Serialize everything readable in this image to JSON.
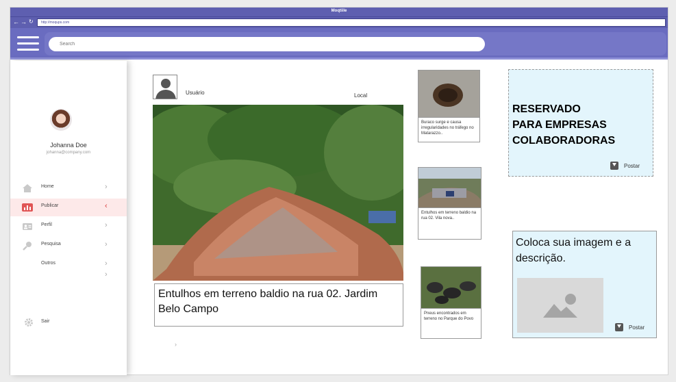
{
  "window": {
    "title": "Moqtiile",
    "url": "http://moqups.com"
  },
  "header": {
    "search_placeholder": "Search"
  },
  "profile": {
    "name": "Johanna Doe",
    "email": "johanna@company.com"
  },
  "sidebar": {
    "items": [
      {
        "label": "Home",
        "icon": "home-icon"
      },
      {
        "label": "Publicar",
        "icon": "chart-icon",
        "active": true
      },
      {
        "label": "Perfil",
        "icon": "id-card-icon"
      },
      {
        "label": "Pesquisa",
        "icon": "search-icon"
      },
      {
        "label": "Outros",
        "icon": "none"
      }
    ],
    "logout": "Sair"
  },
  "post": {
    "user": "Usuário",
    "location": "Local",
    "caption": "Entulhos  em terreno baldio na rua  02. Jardim Belo Campo"
  },
  "news": [
    {
      "text": "Buraco surge e causa irregularidades no tráfego no Matarazzo.."
    },
    {
      "text": "Entulhos  em terreno baldio na rua  02. Vila nova.."
    },
    {
      "text": "Pneus encontrados em terreno no Parque do Povo"
    }
  ],
  "reserved": {
    "text": "RESERVADO\nPARA EMPRESAS\nCOLABORADORAS",
    "button": "Postar"
  },
  "upload": {
    "text": "Coloca sua imagem e a descrição.",
    "button": "Postar"
  },
  "colors": {
    "header": "#6a6cc0",
    "accent": "#d94040",
    "panel": "#e3f5fc"
  }
}
